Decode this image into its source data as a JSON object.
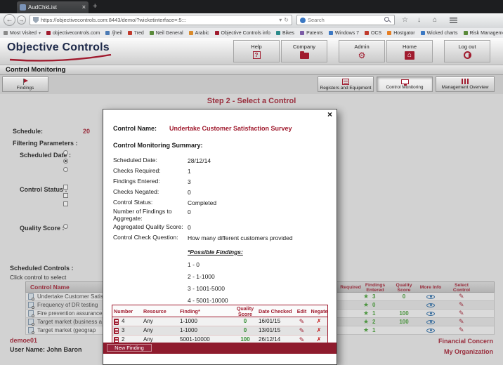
{
  "browser": {
    "tab_title": "AudChkList",
    "url": "https://objectivecontrols.com:8443/demo/?wicketinterface=:5:::",
    "search_placeholder": "Search",
    "bookmarks": [
      "Most Visited",
      "objectivecontrols.com",
      "/jheil",
      "7red",
      "Neil General",
      "Arabic",
      "Objective Controls info",
      "Bikes",
      "Patents",
      "Windows 7",
      "OCS",
      "Hostgator",
      "Wicked charts",
      "Risk Management"
    ]
  },
  "icons": {
    "close": "×",
    "plus": "+",
    "back": "←",
    "forward": "→",
    "reload": "↻",
    "dropdown": "▾",
    "bookmark_star": "☆",
    "download": "↓",
    "home": "⌂",
    "gear": "⚙",
    "question": "?",
    "house": "⌂",
    "star": "★",
    "pencil": "✎",
    "negate": "✗"
  },
  "header": {
    "logo": "Objective Controls",
    "nav": [
      {
        "label": "Help"
      },
      {
        "label": "Company"
      },
      {
        "label": "Admin"
      },
      {
        "label": "Home"
      },
      {
        "label": "Log out"
      }
    ]
  },
  "section_title": "Control Monitoring",
  "toolbar": {
    "left_tab": "Findings",
    "right_tabs": [
      "Registers and Equipment",
      "Control Monitoring",
      "Management Overview"
    ]
  },
  "page": {
    "step_title": "Step 2 - Select a Control",
    "labels": {
      "schedule": "Schedule:",
      "schedule_value_fragment": "20",
      "filtering": "Filtering Parameters :",
      "scheduled_date": "Scheduled Date :",
      "control_status": "Control Status :",
      "quality_score": "Quality Score :",
      "scheduled_controls": "Scheduled Controls :",
      "click_hint": "Click control to select"
    },
    "table": {
      "name_header": "Control Name",
      "right_headers": [
        "Required",
        "Findings Entered",
        "Quality Score",
        "More Info",
        "Select Control"
      ],
      "rows": [
        {
          "name": "Undertake Customer Satisf",
          "findings_entered": "3",
          "quality_score": "0"
        },
        {
          "name": "Frequency of DR testing",
          "findings_entered": "0",
          "quality_score": ""
        },
        {
          "name": "Fire prevention assurance",
          "findings_entered": "1",
          "quality_score": "100"
        },
        {
          "name": "Target market (business a",
          "findings_entered": "2",
          "quality_score": "100"
        },
        {
          "name": "Target market (geograp",
          "findings_entered": "1",
          "quality_score": ""
        }
      ]
    },
    "footer": {
      "org_code": "demoe01",
      "user_name": "User Name: John Baron",
      "concern": "Financial Concern",
      "my_org": "My Organization"
    }
  },
  "modal": {
    "control_name_label": "Control Name:",
    "control_name_value": "Undertake Customer Satisfaction Survey",
    "summary_title": "Control Monitoring Summary:",
    "summary": [
      {
        "label": "Scheduled Date:",
        "value": "28/12/14"
      },
      {
        "label": "Checks Required:",
        "value": "1"
      },
      {
        "label": "Findings Entered:",
        "value": "3"
      },
      {
        "label": "Checks Negated:",
        "value": "0"
      },
      {
        "label": "Control Status:",
        "value": "Completed"
      },
      {
        "label": "Number of Findings to Aggregate:",
        "value": "0"
      },
      {
        "label": "Aggregated Quality Score:",
        "value": "0"
      },
      {
        "label": "Control Check Question:",
        "value": "How many different customers provided"
      }
    ],
    "possible_findings_title": "*Possible Findings:",
    "possible_findings": [
      "1 - 0",
      "2 - 1-1000",
      "3 - 1001-5000",
      "4 - 5001-10000"
    ],
    "findings_table": {
      "headers": {
        "number": "Number",
        "resource": "Resource",
        "finding": "Finding*",
        "quality": "Quality Score",
        "date": "Date Checked",
        "edit": "Edit",
        "negate": "Negate"
      },
      "rows": [
        {
          "number": "4",
          "resource": "Any",
          "finding": "1-1000",
          "quality": "0",
          "date": "16/01/15"
        },
        {
          "number": "3",
          "resource": "Any",
          "finding": "1-1000",
          "quality": "0",
          "date": "13/01/15"
        },
        {
          "number": "2",
          "resource": "Any",
          "finding": "5001-10000",
          "quality": "100",
          "date": "26/12/14"
        }
      ]
    },
    "new_finding_button": "New Finding"
  },
  "colors": {
    "accent": "#a01b2e",
    "modal_bar": "#8e1b2d",
    "findings_green": "#3f9b2f",
    "quality_green": "#2e8b2e"
  }
}
